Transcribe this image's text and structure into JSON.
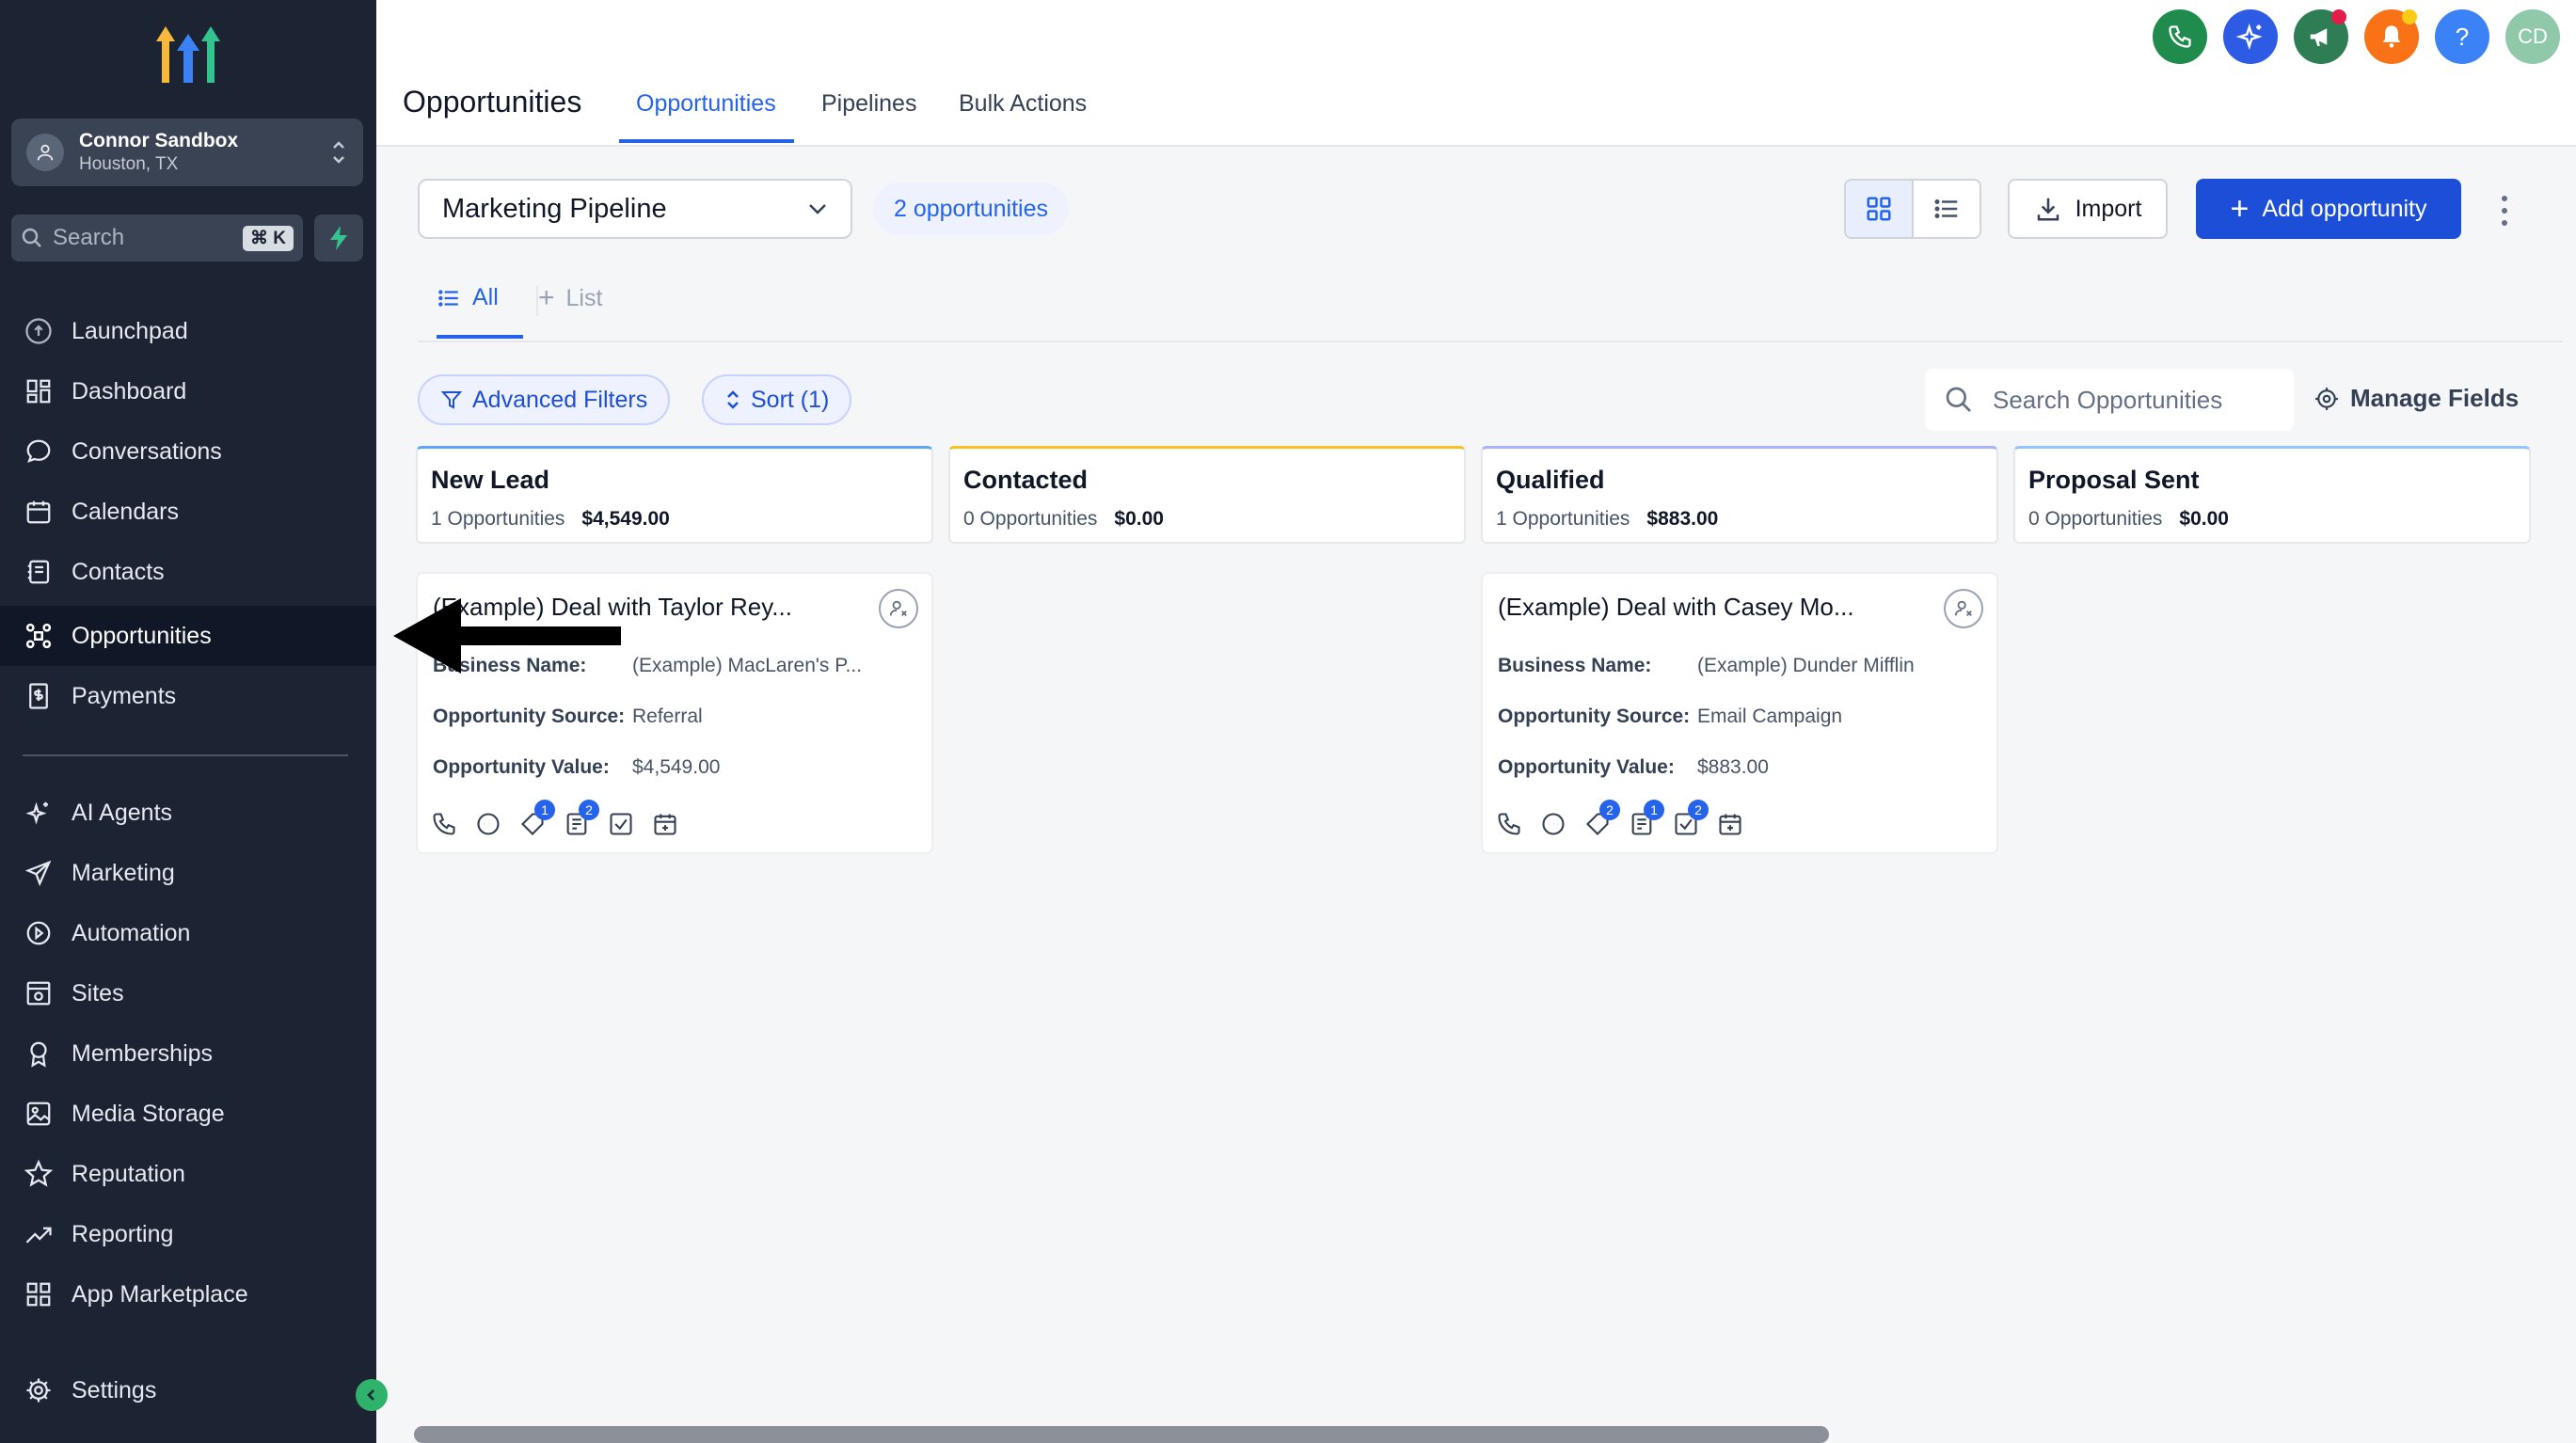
{
  "account": {
    "name": "Connor Sandbox",
    "location": "Houston, TX"
  },
  "sidebar": {
    "search_placeholder": "Search",
    "search_shortcut": "⌘ K",
    "items": [
      {
        "label": "Launchpad",
        "icon": "launchpad-icon"
      },
      {
        "label": "Dashboard",
        "icon": "dashboard-icon"
      },
      {
        "label": "Conversations",
        "icon": "chat-icon"
      },
      {
        "label": "Calendars",
        "icon": "calendar-icon"
      },
      {
        "label": "Contacts",
        "icon": "contacts-icon"
      },
      {
        "label": "Opportunities",
        "icon": "opportunities-icon",
        "active": true
      },
      {
        "label": "Payments",
        "icon": "payments-icon"
      }
    ],
    "items2": [
      {
        "label": "AI Agents",
        "icon": "sparkle-icon"
      },
      {
        "label": "Marketing",
        "icon": "send-icon"
      },
      {
        "label": "Automation",
        "icon": "automation-icon"
      },
      {
        "label": "Sites",
        "icon": "sites-icon"
      },
      {
        "label": "Memberships",
        "icon": "membership-icon"
      },
      {
        "label": "Media Storage",
        "icon": "image-icon"
      },
      {
        "label": "Reputation",
        "icon": "star-icon"
      },
      {
        "label": "Reporting",
        "icon": "trend-icon"
      },
      {
        "label": "App Marketplace",
        "icon": "grid-icon"
      }
    ],
    "settings": "Settings"
  },
  "header": {
    "title": "Opportunities",
    "tabs": [
      "Opportunities",
      "Pipelines",
      "Bulk Actions"
    ],
    "avatar_initials": "CD",
    "colors": {
      "phone": "#1f8b4c",
      "ai": "#2d5be3",
      "megaphone": "#2e7d54",
      "bell": "#f97316",
      "help": "#3b82f6"
    }
  },
  "toolbar": {
    "pipeline": "Marketing Pipeline",
    "opportunities_count": "2 opportunities",
    "import_label": "Import",
    "add_label": "Add opportunity"
  },
  "list_tabs": {
    "all": "All",
    "add": "List"
  },
  "filters": {
    "advanced": "Advanced Filters",
    "sort": "Sort (1)",
    "search_placeholder": "Search Opportunities",
    "manage_fields": "Manage Fields"
  },
  "columns": [
    {
      "name": "New Lead",
      "count": "1 Opportunities",
      "amount": "$4,549.00",
      "color": "#60a5fa"
    },
    {
      "name": "Contacted",
      "count": "0 Opportunities",
      "amount": "$0.00",
      "color": "#fbbf24"
    },
    {
      "name": "Qualified",
      "count": "1 Opportunities",
      "amount": "$883.00",
      "color": "#a5b4fc"
    },
    {
      "name": "Proposal Sent",
      "count": "0 Opportunities",
      "amount": "$0.00",
      "color": "#93c5fd"
    }
  ],
  "cards": [
    {
      "title": "(Example) Deal with Taylor Rey...",
      "k1": "Business Name:",
      "v1": "(Example) MacLaren's P...",
      "k2": "Opportunity Source:",
      "v2": "Referral",
      "k3": "Opportunity Value:",
      "v3": "$4,549.00",
      "badges": [
        "",
        "",
        "1",
        "2",
        "",
        ""
      ]
    },
    {
      "title": "(Example) Deal with Casey Mo...",
      "k1": "Business Name:",
      "v1": "(Example) Dunder Mifflin",
      "k2": "Opportunity Source:",
      "v2": "Email Campaign",
      "k3": "Opportunity Value:",
      "v3": "$883.00",
      "badges": [
        "",
        "",
        "2",
        "1",
        "2",
        ""
      ]
    }
  ]
}
